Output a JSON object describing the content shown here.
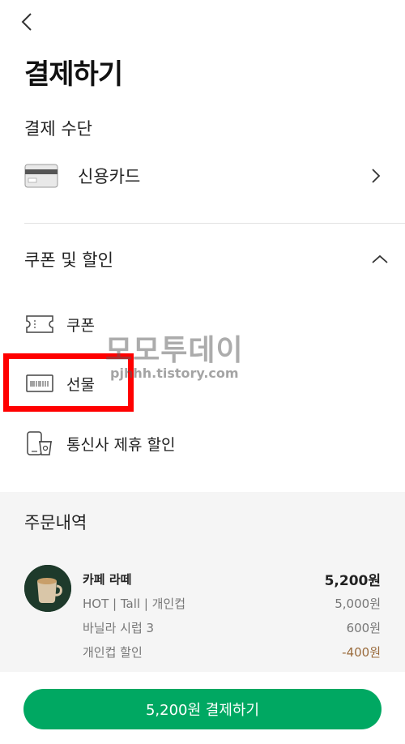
{
  "header": {
    "title": "결제하기"
  },
  "payment": {
    "section_label": "결제 수단",
    "method": "신용카드"
  },
  "coupon": {
    "section_label": "쿠폰 및 할인",
    "options": [
      {
        "label": "쿠폰"
      },
      {
        "label": "선물"
      },
      {
        "label": "통신사 제휴 할인"
      }
    ]
  },
  "watermark": {
    "title": "모모투데이",
    "url": "pjhhh.tistory.com"
  },
  "order": {
    "section_label": "주문내역",
    "item_name": "카페 라떼",
    "item_total": "5,200원",
    "lines": [
      {
        "label": "HOT | Tall | 개인컵",
        "value": "5,000원"
      },
      {
        "label": "바닐라 시럽 3",
        "value": "600원"
      },
      {
        "label": "개인컵 할인",
        "value": "-400원"
      }
    ]
  },
  "pay_button": {
    "label": "5,200원 결제하기"
  },
  "colors": {
    "accent": "#00a862",
    "highlight": "#ff0000",
    "discount": "#9a6b3c"
  }
}
